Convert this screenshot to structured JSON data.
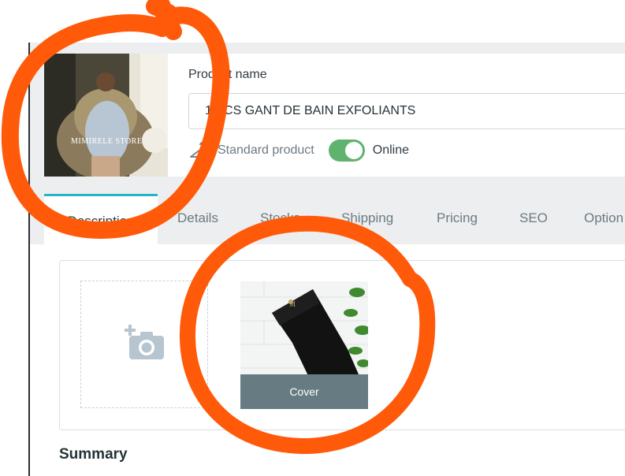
{
  "product": {
    "name_label": "Product name",
    "name_value": "1 PCS GANT DE BAIN EXFOLIANTS",
    "type_label": "Standard product",
    "status_label": "Online",
    "status_on": true,
    "thumb_caption": "MIMIRELE STORE"
  },
  "tabs": [
    {
      "label": "Description",
      "active": true
    },
    {
      "label": "Details"
    },
    {
      "label": "Stocks"
    },
    {
      "label": "Shipping"
    },
    {
      "label": "Pricing"
    },
    {
      "label": "SEO"
    },
    {
      "label": "Option"
    }
  ],
  "images": {
    "cover_label": "Cover"
  },
  "summary_heading": "Summary",
  "colors": {
    "accent": "#25b4c8",
    "toggle_on": "#5fb36f",
    "annotation": "#ff5a0a",
    "cover_bar": "#677c82"
  }
}
